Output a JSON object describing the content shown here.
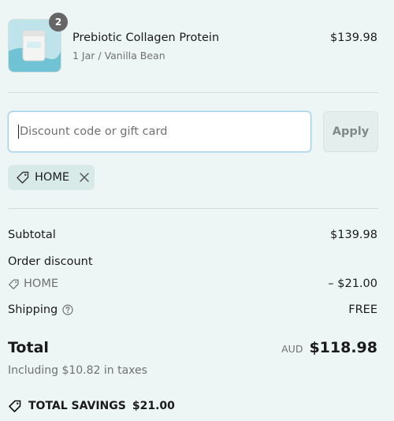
{
  "line_item": {
    "quantity": "2",
    "name": "Prebiotic Collagen Protein",
    "variant": "1 Jar / Vanilla Bean",
    "price": "$139.98"
  },
  "discount": {
    "placeholder": "Discount code or gift card",
    "apply_label": "Apply",
    "applied_code": "HOME"
  },
  "summary": {
    "subtotal_label": "Subtotal",
    "subtotal_value": "$139.98",
    "order_discount_label": "Order discount",
    "discount_code": "HOME",
    "discount_value": "– $21.00",
    "shipping_label": "Shipping",
    "shipping_value": "FREE",
    "total_label": "Total",
    "currency": "AUD",
    "total_value": "$118.98",
    "tax_note": "Including $10.82 in taxes",
    "savings_label": "TOTAL SAVINGS",
    "savings_value": "$21.00"
  },
  "icons": {
    "tag": "tag-icon",
    "close": "close-icon",
    "help": "question-circle-icon"
  },
  "colors": {
    "background": "#eef6f5",
    "input_border": "#9fd0e6",
    "badge": "#666666",
    "muted_text": "#707070"
  }
}
